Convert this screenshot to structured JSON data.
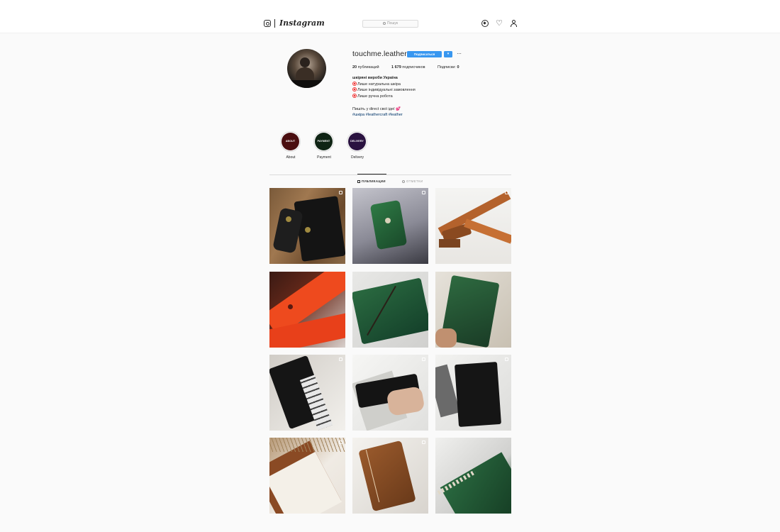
{
  "header": {
    "wordmark": "Instagram",
    "search_placeholder": "Пошук",
    "icons": [
      "instagram-glyph-icon",
      "explore-compass-icon",
      "heart-icon",
      "profile-icon"
    ]
  },
  "profile": {
    "username": "touchme.leather",
    "follow_label": "Подписаться",
    "more_label": "▾",
    "options_label": "···",
    "stats": {
      "posts_count": "20",
      "posts_label": "публикаций",
      "followers_count": "1 679",
      "followers_label": "подписчиков",
      "following_label": "Подписки:",
      "following_count": "0"
    },
    "bio": {
      "name": "шкіряні вироби Україна",
      "line1": "Лише натуральна шкіра",
      "line2": "Лише індивідуальні замовлення",
      "line3": "Лише ручна робота",
      "line4": "Пишіть у direct свої ідеї 💕",
      "tags": "#шкіра #leathercraft #leather"
    }
  },
  "highlights": [
    {
      "circle_text": "ABOUT",
      "label": "About",
      "color": "#4a0e10"
    },
    {
      "circle_text": "PAYMENT",
      "label": "Payment",
      "color": "#0f2414"
    },
    {
      "circle_text": "DELIVERY",
      "label": "Delivery",
      "color": "#2a1240"
    }
  ],
  "tabs": [
    {
      "label": "ПУБЛИКАЦИИ",
      "active": true
    },
    {
      "label": "ОТМЕТКИ",
      "active": false
    }
  ],
  "colors": {
    "accent": "#3897f0",
    "background": "#fafafa",
    "text": "#262626",
    "border": "#dbdbdb"
  },
  "posts": [
    {
      "subject": "black leather key holder on wooden table",
      "multi": true
    },
    {
      "subject": "green leather key holder",
      "multi": true
    },
    {
      "subject": "brown leather strap",
      "multi": true
    },
    {
      "subject": "red leather belt with stamp",
      "multi": false
    },
    {
      "subject": "green leather notebook cover",
      "multi": false
    },
    {
      "subject": "green leather notebook held in hands",
      "multi": false
    },
    {
      "subject": "black leather passport cover",
      "multi": true
    },
    {
      "subject": "black wallet held in hand",
      "multi": true
    },
    {
      "subject": "black leather notebook cover standing",
      "multi": true
    },
    {
      "subject": "leather cover with dried grass",
      "multi": true
    },
    {
      "subject": "brown leather passport cover",
      "multi": true
    },
    {
      "subject": "green leather notebook with stitching",
      "multi": false
    }
  ]
}
